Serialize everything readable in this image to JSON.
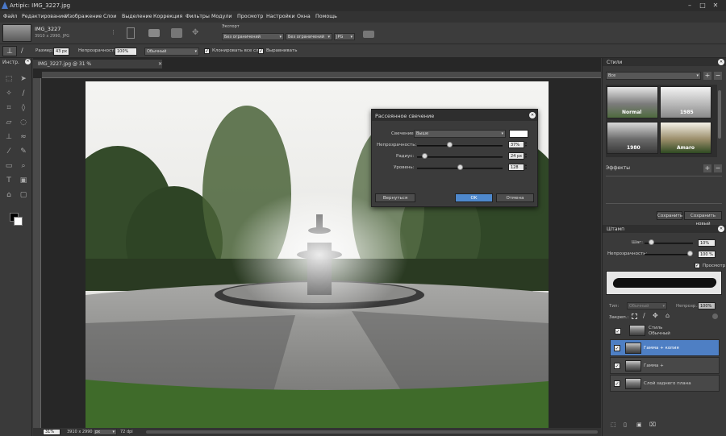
{
  "title_bar": {
    "title": "Artipic: IMG_3227.jpg",
    "buttons": [
      "–",
      "□",
      "✕"
    ]
  },
  "menu": [
    "Файл",
    "Редактирование",
    "Изображение",
    "Слои",
    "Выделение",
    "Коррекция",
    "Фильтры",
    "Модули",
    "Просмотр",
    "Настройки",
    "Окна",
    "Помощь"
  ],
  "top_panel": {
    "file_name": "IMG_3227",
    "file_info": "3910 x 2990, JPG",
    "export_label": "Экспорт",
    "export_width": "Без ограничений",
    "export_height": "Без ограничений",
    "export_format": "JPG"
  },
  "options": {
    "size_label": "Размер:",
    "size_value": "43 px",
    "opacity_label": "Непрозрачность:",
    "opacity_value": "100%",
    "mode_value": "Обычный",
    "clone_all_label": "Клонировать все слои",
    "align_label": "Выравнивать"
  },
  "toolbar": {
    "title": "Инстр."
  },
  "document": {
    "tab": "IMG_3227.jpg @ 31 %",
    "zoom": "31%",
    "dims": "3910 x 2990",
    "unit": "px",
    "dpi": "72 dpi"
  },
  "dialog": {
    "title": "Рассеянное свечение",
    "glow_label": "Свечение:",
    "glow_value": "Выше",
    "opacity_label": "Непрозрачность:",
    "opacity_value": "37%",
    "opacity_level": 0.37,
    "radius_label": "Радиус:",
    "radius_value": "24 px",
    "radius_level": 0.06,
    "levels_label": "Уровень:",
    "levels_value": "128",
    "levels_level": 0.5,
    "reset_label": "Вернуться",
    "ok_label": "OK",
    "cancel_label": "Отмена"
  },
  "styles_panel": {
    "title": "Стили",
    "filter": "Все",
    "thumbs": [
      "Normal",
      "1985",
      "1980",
      "Amaro"
    ],
    "effects_label": "Эффекты",
    "save_label": "Сохранить",
    "save_new_label": "Сохранить новый"
  },
  "stamp_panel": {
    "title": "Штамп",
    "step_label": "Шаг:",
    "step_value": "10%",
    "step_level": 0.1,
    "opacity_label": "Непрозрачность:",
    "opacity_value": "100 %",
    "opacity_level": 1.0,
    "preview_label": "Просмотр"
  },
  "layers": {
    "type_label": "Тип:",
    "type_value": "Обычный",
    "opacity_label": "Непрозр.:",
    "opacity_value": "100%",
    "lock_label": "Закреп.:",
    "items": [
      {
        "name": "Стиль",
        "sub": "Обычный"
      },
      {
        "name": "Гамма + копия",
        "sub": ""
      },
      {
        "name": "Гамма +",
        "sub": ""
      },
      {
        "name": "Слой заднего плана",
        "sub": ""
      }
    ]
  }
}
